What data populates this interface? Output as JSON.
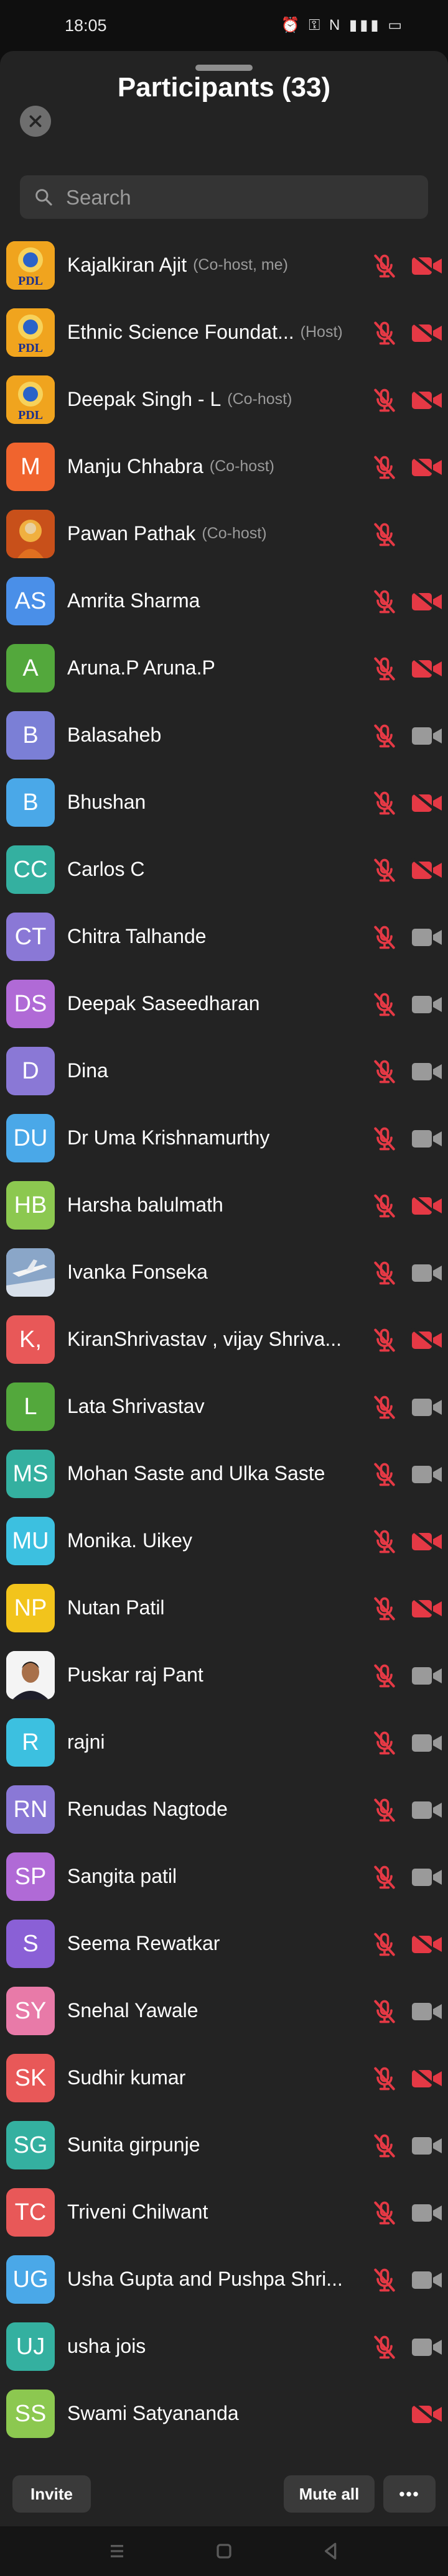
{
  "status_bar": {
    "time": "18:05",
    "icons": [
      "alarm-icon",
      "vpn-key-icon",
      "nfc-icon",
      "signal-icon",
      "battery-icon"
    ]
  },
  "header": {
    "title": "Participants (33)"
  },
  "search": {
    "placeholder": "Search",
    "value": ""
  },
  "colors": {
    "sheet_bg": "#232323",
    "muted_red": "#e53945",
    "icon_grey": "#9a9a9a"
  },
  "participants": [
    {
      "name": "Kajalkiran Ajit",
      "role": "(Co-host, me)",
      "avatar_type": "pdl",
      "initials": "PDL",
      "avatar_color": "#e8a21c",
      "mic": "muted",
      "video": "off"
    },
    {
      "name": "Ethnic Science Foundat...",
      "role": "(Host)",
      "avatar_type": "pdl",
      "initials": "PDL",
      "avatar_color": "#e8a21c",
      "mic": "muted",
      "video": "off"
    },
    {
      "name": "Deepak Singh - L",
      "role": "(Co-host)",
      "avatar_type": "pdl",
      "initials": "PDL",
      "avatar_color": "#e8a21c",
      "mic": "muted",
      "video": "off"
    },
    {
      "name": "Manju Chhabra",
      "role": "(Co-host)",
      "avatar_type": "initials",
      "initials": "M",
      "avatar_color": "#f0642e",
      "mic": "muted",
      "video": "off"
    },
    {
      "name": "Pawan Pathak",
      "role": "(Co-host)",
      "avatar_type": "photo",
      "initials": "",
      "avatar_color": "#c8501a",
      "mic": "muted",
      "video": "none"
    },
    {
      "name": "Amrita Sharma",
      "role": "",
      "avatar_type": "initials",
      "initials": "AS",
      "avatar_color": "#4a8fe8",
      "mic": "muted",
      "video": "off"
    },
    {
      "name": "Aruna.P Aruna.P",
      "role": "",
      "avatar_type": "initials",
      "initials": "A",
      "avatar_color": "#53a83c",
      "mic": "muted",
      "video": "off"
    },
    {
      "name": "Balasaheb",
      "role": "",
      "avatar_type": "initials",
      "initials": "B",
      "avatar_color": "#7b7fd6",
      "mic": "muted",
      "video": "on"
    },
    {
      "name": "Bhushan",
      "role": "",
      "avatar_type": "initials",
      "initials": "B",
      "avatar_color": "#4aa8e8",
      "mic": "muted",
      "video": "off"
    },
    {
      "name": "Carlos C",
      "role": "",
      "avatar_type": "initials",
      "initials": "CC",
      "avatar_color": "#34b0a0",
      "mic": "muted",
      "video": "off"
    },
    {
      "name": "Chitra Talhande",
      "role": "",
      "avatar_type": "initials",
      "initials": "CT",
      "avatar_color": "#8a78d6",
      "mic": "muted",
      "video": "on"
    },
    {
      "name": "Deepak Saseedharan",
      "role": "",
      "avatar_type": "initials",
      "initials": "DS",
      "avatar_color": "#b06ad6",
      "mic": "muted",
      "video": "on"
    },
    {
      "name": "Dina",
      "role": "",
      "avatar_type": "initials",
      "initials": "D",
      "avatar_color": "#8a78d6",
      "mic": "muted",
      "video": "on"
    },
    {
      "name": "Dr Uma Krishnamurthy",
      "role": "",
      "avatar_type": "initials",
      "initials": "DU",
      "avatar_color": "#4aa8e8",
      "mic": "muted",
      "video": "on"
    },
    {
      "name": "Harsha balulmath",
      "role": "",
      "avatar_type": "initials",
      "initials": "HB",
      "avatar_color": "#8cc850",
      "mic": "muted",
      "video": "off"
    },
    {
      "name": "Ivanka Fonseka",
      "role": "",
      "avatar_type": "plane",
      "initials": "",
      "avatar_color": "#9ab2d0",
      "mic": "muted",
      "video": "on"
    },
    {
      "name": "KiranShrivastav , vijay Shriva...",
      "role": "",
      "avatar_type": "initials",
      "initials": "K,",
      "avatar_color": "#e85858",
      "mic": "muted",
      "video": "off"
    },
    {
      "name": "Lata Shrivastav",
      "role": "",
      "avatar_type": "initials",
      "initials": "L",
      "avatar_color": "#53a83c",
      "mic": "muted",
      "video": "on"
    },
    {
      "name": "Mohan Saste and Ulka Saste",
      "role": "",
      "avatar_type": "initials",
      "initials": "MS",
      "avatar_color": "#34b0a0",
      "mic": "muted",
      "video": "on"
    },
    {
      "name": "Monika. Uikey",
      "role": "",
      "avatar_type": "initials",
      "initials": "MU",
      "avatar_color": "#3cc0e0",
      "mic": "muted",
      "video": "off"
    },
    {
      "name": "Nutan Patil",
      "role": "",
      "avatar_type": "initials",
      "initials": "NP",
      "avatar_color": "#f2c41c",
      "mic": "muted",
      "video": "off"
    },
    {
      "name": "Puskar raj Pant",
      "role": "",
      "avatar_type": "portrait",
      "initials": "",
      "avatar_color": "#f4f4f4",
      "mic": "muted",
      "video": "on"
    },
    {
      "name": "rajni",
      "role": "",
      "avatar_type": "initials",
      "initials": "R",
      "avatar_color": "#3cc0e0",
      "mic": "muted",
      "video": "on"
    },
    {
      "name": "Renudas Nagtode",
      "role": "",
      "avatar_type": "initials",
      "initials": "RN",
      "avatar_color": "#8a78d6",
      "mic": "muted",
      "video": "on"
    },
    {
      "name": "Sangita patil",
      "role": "",
      "avatar_type": "initials",
      "initials": "SP",
      "avatar_color": "#b06ad6",
      "mic": "muted",
      "video": "on"
    },
    {
      "name": "Seema  Rewatkar",
      "role": "",
      "avatar_type": "initials",
      "initials": "S",
      "avatar_color": "#8a60d6",
      "mic": "muted",
      "video": "off"
    },
    {
      "name": "Snehal Yawale",
      "role": "",
      "avatar_type": "initials",
      "initials": "SY",
      "avatar_color": "#e87aa8",
      "mic": "muted",
      "video": "on"
    },
    {
      "name": "Sudhir kumar",
      "role": "",
      "avatar_type": "initials",
      "initials": "SK",
      "avatar_color": "#e85858",
      "mic": "muted",
      "video": "off"
    },
    {
      "name": "Sunita girpunje",
      "role": "",
      "avatar_type": "initials",
      "initials": "SG",
      "avatar_color": "#34b0a0",
      "mic": "muted",
      "video": "on"
    },
    {
      "name": "Triveni Chilwant",
      "role": "",
      "avatar_type": "initials",
      "initials": "TC",
      "avatar_color": "#e85858",
      "mic": "muted",
      "video": "on"
    },
    {
      "name": "Usha Gupta and Pushpa Shri...",
      "role": "",
      "avatar_type": "initials",
      "initials": "UG",
      "avatar_color": "#4aa8e8",
      "mic": "muted",
      "video": "on"
    },
    {
      "name": "usha jois",
      "role": "",
      "avatar_type": "initials",
      "initials": "UJ",
      "avatar_color": "#34b0a0",
      "mic": "muted",
      "video": "on"
    },
    {
      "name": "Swami Satyananda",
      "role": "",
      "avatar_type": "initials",
      "initials": "SS",
      "avatar_color": "#8cc850",
      "mic": "none",
      "video": "off"
    }
  ],
  "footer": {
    "invite_label": "Invite",
    "mute_all_label": "Mute all",
    "more_label": "•••"
  },
  "nav_bar": {
    "icons": [
      "menu-icon",
      "home-icon",
      "back-icon"
    ]
  }
}
